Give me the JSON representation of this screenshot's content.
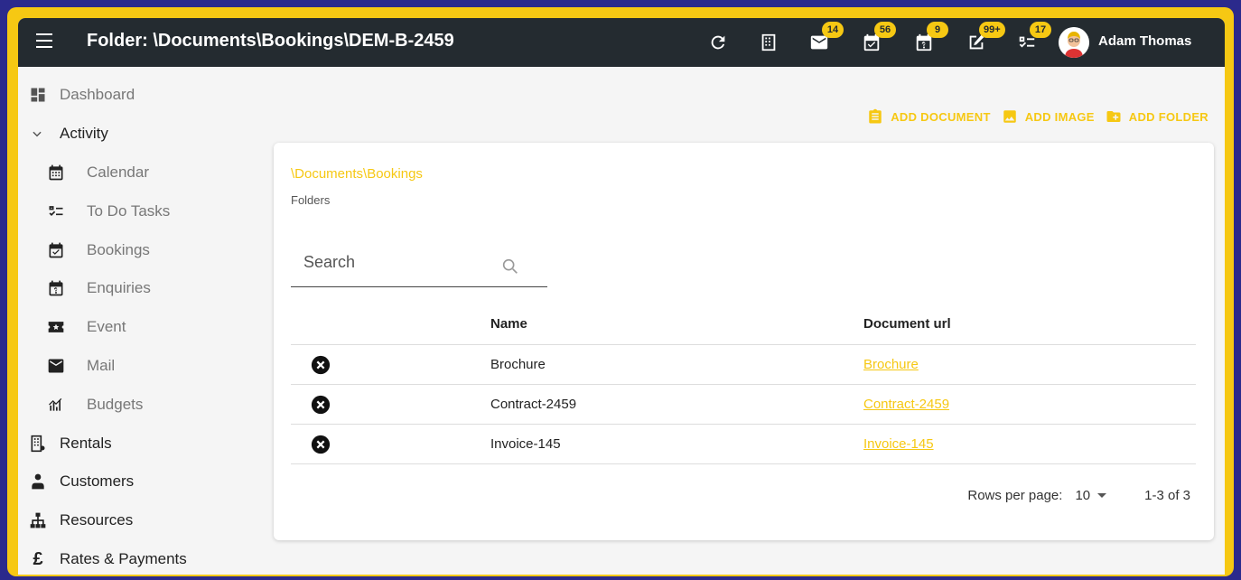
{
  "header": {
    "title": "Folder: \\Documents\\Bookings\\DEM-B-2459",
    "username": "Adam Thomas",
    "icons": [
      {
        "name": "refresh-icon",
        "badge": ""
      },
      {
        "name": "building-icon",
        "badge": ""
      },
      {
        "name": "mail-icon",
        "badge": "14"
      },
      {
        "name": "calendar-check-icon",
        "badge": "56"
      },
      {
        "name": "calendar-question-icon",
        "badge": "9"
      },
      {
        "name": "edit-icon",
        "badge": "99+"
      },
      {
        "name": "tasks-icon",
        "badge": "17"
      }
    ]
  },
  "sidebar": {
    "items": [
      {
        "label": "Dashboard",
        "icon": "dashboard-icon"
      },
      {
        "label": "Activity",
        "icon": "chevron-down-icon"
      },
      {
        "label": "Calendar",
        "icon": "calendar-icon"
      },
      {
        "label": "To Do Tasks",
        "icon": "checklist-icon"
      },
      {
        "label": "Bookings",
        "icon": "calendar-check-icon"
      },
      {
        "label": "Enquiries",
        "icon": "calendar-question-icon"
      },
      {
        "label": "Event",
        "icon": "ticket-icon"
      },
      {
        "label": "Mail",
        "icon": "mail-icon"
      },
      {
        "label": "Budgets",
        "icon": "chart-icon"
      },
      {
        "label": "Rentals",
        "icon": "building-icon"
      },
      {
        "label": "Customers",
        "icon": "customers-icon"
      },
      {
        "label": "Resources",
        "icon": "hierarchy-icon"
      },
      {
        "label": "Rates & Payments",
        "icon": "pound-icon"
      }
    ]
  },
  "actions": {
    "add_document": "ADD DOCUMENT",
    "add_image": "ADD IMAGE",
    "add_folder": "ADD FOLDER"
  },
  "card": {
    "breadcrumb": "\\Documents\\Bookings",
    "subtitle": "Folders",
    "search_placeholder": "Search",
    "columns": {
      "name": "Name",
      "url": "Document url"
    },
    "rows": [
      {
        "name": "Brochure",
        "url": "Brochure"
      },
      {
        "name": "Contract-2459",
        "url": "Contract-2459"
      },
      {
        "name": "Invoice-145",
        "url": "Invoice-145"
      }
    ],
    "pager": {
      "rows_per_page_label": "Rows per page:",
      "rows_per_page": "10",
      "range": "1-3 of 3"
    }
  },
  "colors": {
    "accent": "#f6c813",
    "topbar": "#242b30",
    "outer_border": "#2b2a8c"
  }
}
